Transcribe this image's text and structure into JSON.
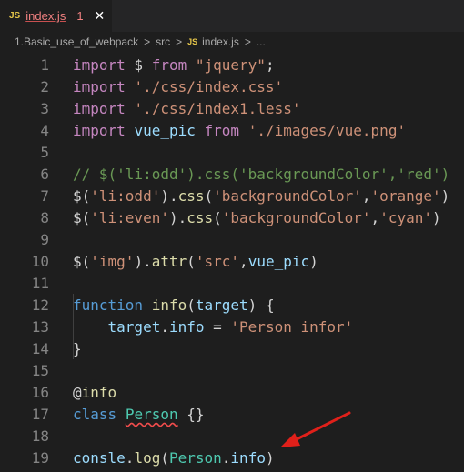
{
  "tab": {
    "lang_badge": "JS",
    "filename": "index.js",
    "problems": "1",
    "close_glyph": "✕"
  },
  "breadcrumb": {
    "items": [
      "1.Basic_use_of_webpack",
      "src",
      "index.js",
      "..."
    ],
    "lang_badge": "JS",
    "separator": ">"
  },
  "lines": [
    {
      "n": "1",
      "tokens": [
        {
          "t": "import",
          "c": "kwp"
        },
        {
          "t": " $ ",
          "c": "plain"
        },
        {
          "t": "from",
          "c": "kwp"
        },
        {
          "t": " ",
          "c": "plain"
        },
        {
          "t": "\"jquery\"",
          "c": "str"
        },
        {
          "t": ";",
          "c": "plain"
        }
      ]
    },
    {
      "n": "2",
      "tokens": [
        {
          "t": "import",
          "c": "kwp"
        },
        {
          "t": " ",
          "c": "plain"
        },
        {
          "t": "'./css/index.css'",
          "c": "str"
        }
      ]
    },
    {
      "n": "3",
      "tokens": [
        {
          "t": "import",
          "c": "kwp"
        },
        {
          "t": " ",
          "c": "plain"
        },
        {
          "t": "'./css/index1.less'",
          "c": "str"
        }
      ]
    },
    {
      "n": "4",
      "tokens": [
        {
          "t": "import",
          "c": "kwp"
        },
        {
          "t": " ",
          "c": "plain"
        },
        {
          "t": "vue_pic",
          "c": "var"
        },
        {
          "t": " ",
          "c": "plain"
        },
        {
          "t": "from",
          "c": "kwp"
        },
        {
          "t": " ",
          "c": "plain"
        },
        {
          "t": "'./images/vue.png'",
          "c": "str"
        }
      ]
    },
    {
      "n": "5",
      "tokens": []
    },
    {
      "n": "6",
      "tokens": [
        {
          "t": "// $('li:odd').css('backgroundColor','red')",
          "c": "cmt"
        }
      ]
    },
    {
      "n": "7",
      "tokens": [
        {
          "t": "$(",
          "c": "plain"
        },
        {
          "t": "'li:odd'",
          "c": "str"
        },
        {
          "t": ").",
          "c": "plain"
        },
        {
          "t": "css",
          "c": "fn"
        },
        {
          "t": "(",
          "c": "plain"
        },
        {
          "t": "'backgroundColor'",
          "c": "str"
        },
        {
          "t": ",",
          "c": "plain"
        },
        {
          "t": "'orange'",
          "c": "str"
        },
        {
          "t": ")",
          "c": "plain"
        }
      ]
    },
    {
      "n": "8",
      "tokens": [
        {
          "t": "$(",
          "c": "plain"
        },
        {
          "t": "'li:even'",
          "c": "str"
        },
        {
          "t": ").",
          "c": "plain"
        },
        {
          "t": "css",
          "c": "fn"
        },
        {
          "t": "(",
          "c": "plain"
        },
        {
          "t": "'backgroundColor'",
          "c": "str"
        },
        {
          "t": ",",
          "c": "plain"
        },
        {
          "t": "'cyan'",
          "c": "str"
        },
        {
          "t": ")",
          "c": "plain"
        }
      ]
    },
    {
      "n": "9",
      "tokens": []
    },
    {
      "n": "10",
      "tokens": [
        {
          "t": "$(",
          "c": "plain"
        },
        {
          "t": "'img'",
          "c": "str"
        },
        {
          "t": ").",
          "c": "plain"
        },
        {
          "t": "attr",
          "c": "fn"
        },
        {
          "t": "(",
          "c": "plain"
        },
        {
          "t": "'src'",
          "c": "str"
        },
        {
          "t": ",",
          "c": "plain"
        },
        {
          "t": "vue_pic",
          "c": "var"
        },
        {
          "t": ")",
          "c": "plain"
        }
      ]
    },
    {
      "n": "11",
      "tokens": []
    },
    {
      "n": "12",
      "tokens": [
        {
          "t": "function",
          "c": "kw"
        },
        {
          "t": " ",
          "c": "plain"
        },
        {
          "t": "info",
          "c": "fn"
        },
        {
          "t": "(",
          "c": "plain"
        },
        {
          "t": "target",
          "c": "var"
        },
        {
          "t": ") {",
          "c": "plain"
        }
      ]
    },
    {
      "n": "13",
      "tokens": [
        {
          "t": "    ",
          "c": "plain"
        },
        {
          "t": "target",
          "c": "var"
        },
        {
          "t": ".",
          "c": "plain"
        },
        {
          "t": "info",
          "c": "var"
        },
        {
          "t": " = ",
          "c": "plain"
        },
        {
          "t": "'Person infor'",
          "c": "str"
        }
      ]
    },
    {
      "n": "14",
      "tokens": [
        {
          "t": "}",
          "c": "plain"
        }
      ]
    },
    {
      "n": "15",
      "tokens": []
    },
    {
      "n": "16",
      "tokens": [
        {
          "t": "@",
          "c": "plain"
        },
        {
          "t": "info",
          "c": "fn"
        }
      ]
    },
    {
      "n": "17",
      "tokens": [
        {
          "t": "class",
          "c": "kw"
        },
        {
          "t": " ",
          "c": "plain"
        },
        {
          "t": "Person",
          "c": "cls squiggle"
        },
        {
          "t": " {}",
          "c": "plain"
        }
      ]
    },
    {
      "n": "18",
      "tokens": []
    },
    {
      "n": "19",
      "tokens": [
        {
          "t": "consle",
          "c": "var"
        },
        {
          "t": ".",
          "c": "plain"
        },
        {
          "t": "log",
          "c": "fn"
        },
        {
          "t": "(",
          "c": "plain"
        },
        {
          "t": "Person",
          "c": "cls"
        },
        {
          "t": ".",
          "c": "plain"
        },
        {
          "t": "info",
          "c": "var"
        },
        {
          "t": ")",
          "c": "plain"
        }
      ]
    }
  ],
  "colors": {
    "background": "#1e1e1e",
    "tabbar": "#252526",
    "annotation_arrow": "#e0201a"
  }
}
